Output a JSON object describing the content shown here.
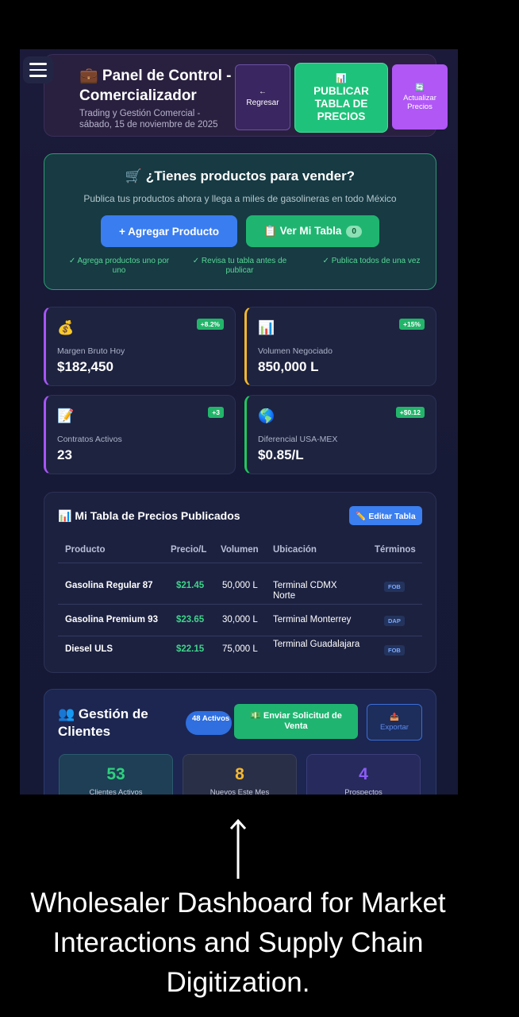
{
  "header": {
    "title": "💼 Panel de Control - Comercializador",
    "subtitle": "Trading y Gestión Comercial - sábado, 15 de noviembre de 2025",
    "back_arrow": "←",
    "back_label": "Regresar",
    "publish_icon": "📊",
    "publish_label": "PUBLICAR TABLA DE PRECIOS",
    "update_icon": "🔄",
    "update_label": "Actualizar Precios"
  },
  "sell": {
    "title": "🛒 ¿Tienes productos para vender?",
    "subtitle": "Publica tus productos ahora y llega a miles de gasolineras en todo México",
    "add_label": "+ Agregar Producto",
    "view_label": "📋 Ver Mi Tabla",
    "view_count": "0",
    "tips": [
      "✓ Agrega productos uno por uno",
      "✓ Revisa tu tabla antes de publicar",
      "✓ Publica todos de una vez"
    ]
  },
  "stats": [
    {
      "icon": "💰",
      "badge": "+8.2%",
      "label": "Margen Bruto Hoy",
      "value": "$182,450",
      "accent": "#a855f7"
    },
    {
      "icon": "📊",
      "badge": "+15%",
      "label": "Volumen Negociado",
      "value": "850,000 L",
      "accent": "#f5b82e"
    },
    {
      "icon": "📝",
      "badge": "+3",
      "label": "Contratos Activos",
      "value": "23",
      "accent": "#a855f7"
    },
    {
      "icon": "🌎",
      "badge": "+$0.12",
      "label": "Diferencial USA-MEX",
      "value": "$0.85/L",
      "accent": "#22c55e"
    }
  ],
  "prices": {
    "title": "📊 Mi Tabla de Precios Publicados",
    "edit_label": "✏️ Editar Tabla",
    "headers": [
      "Producto",
      "Precio/L",
      "Volumen",
      "Ubicación",
      "Términos"
    ],
    "rows": [
      {
        "product": "Gasolina Regular 87",
        "price": "$21.45",
        "volume": "50,000 L",
        "location": "Terminal CDMX Norte",
        "terms": "FOB"
      },
      {
        "product": "Gasolina Premium 93",
        "price": "$23.65",
        "volume": "30,000 L",
        "location": "Terminal Monterrey",
        "terms": "DAP"
      },
      {
        "product": "Diesel ULS",
        "price": "$22.15",
        "volume": "75,000 L",
        "location": "Terminal Guadalajara",
        "terms": "FOB"
      }
    ]
  },
  "clients": {
    "title": "👥 Gestión de Clientes",
    "active_pill": "48 Activos",
    "send_label": "💵 Enviar Solicitud de Venta",
    "export_icon": "📤",
    "export_label": "Exportar",
    "metrics": [
      {
        "value": "53",
        "label": "Clientes Activos",
        "color": "#2fd07e"
      },
      {
        "value": "8",
        "label": "Nuevos Este Mes",
        "color": "#f5b82e"
      },
      {
        "value": "4",
        "label": "Prospectos",
        "color": "#8b5cf6"
      }
    ]
  },
  "caption": "Wholesaler Dashboard for Market Interactions and Supply Chain Digitization."
}
